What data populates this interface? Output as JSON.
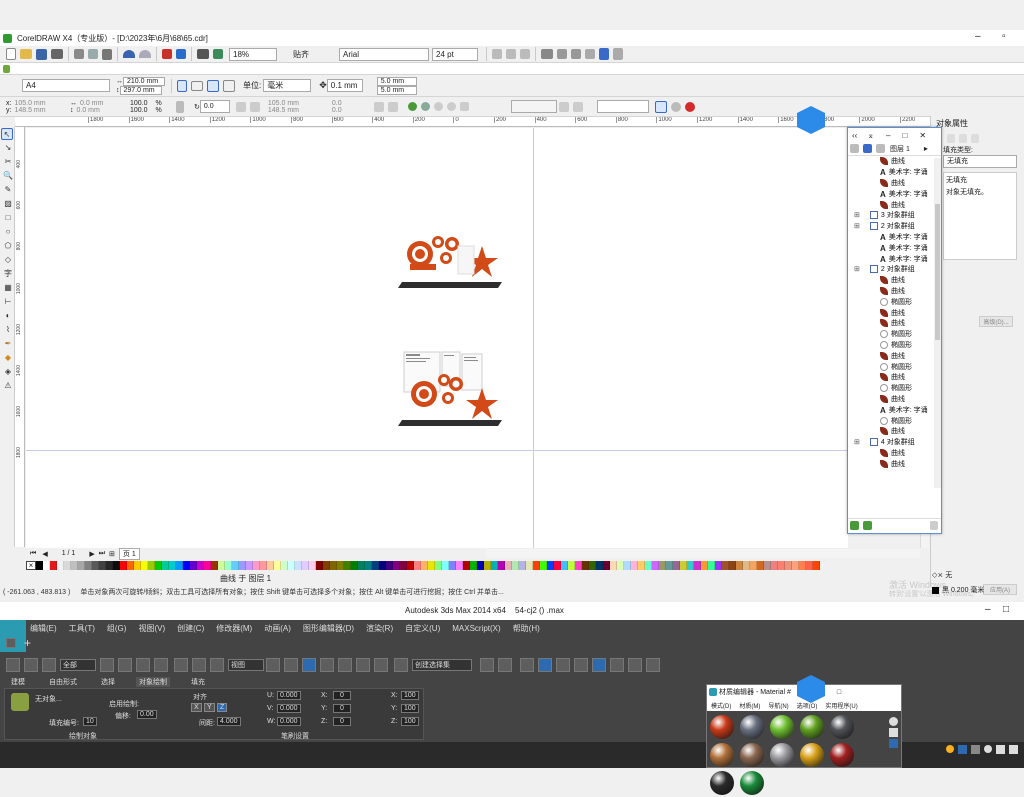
{
  "coreldraw": {
    "title": "CorelDRAW X4（专业版）- [D:\\2023年\\6月\\68\\65.cdr]",
    "window_controls": [
      "–",
      "▫"
    ],
    "zoom": "18%",
    "snap_label": "贴齐",
    "font_name": "Arial",
    "font_size": "24 pt",
    "page_size": "A4",
    "page_width": "210.0 mm",
    "page_height": "297.0 mm",
    "units_label": "单位:",
    "units_value": "毫米",
    "nudge": "0.1 mm",
    "dup_x": "5.0 mm",
    "dup_y": "5.0 mm",
    "pos_x": "105.0 mm",
    "pos_y": "148.5 mm",
    "size_w": "0.0 mm",
    "size_h": "0.0 mm",
    "scale_x": "100.0",
    "scale_y": "100.0",
    "pct": "%",
    "angle": "0.0",
    "center_x": "105.0 mm",
    "center_y": "148.5 mm",
    "skew_x": "0.0",
    "skew_y": "0.0",
    "ruler_ticks": [
      "1800",
      "1600",
      "1400",
      "1200",
      "1000",
      "800",
      "600",
      "400",
      "200",
      "0",
      "200",
      "400",
      "600",
      "800",
      "1000",
      "1200",
      "1400",
      "1600",
      "1800",
      "2000",
      "2200",
      "2400"
    ],
    "vruler_ticks": [
      "200",
      "400",
      "600",
      "800",
      "1000",
      "1200",
      "1400",
      "1600",
      "1800"
    ],
    "page_nav": "1 / 1",
    "page_tab": "页 1",
    "status_center": "曲线 于 图层 1",
    "status_left": "( -261.063 , 483.813 )",
    "status_hint": "单击对象两次可旋转/倾斜；双击工具可选择所有对象；按住 Shift 键单击可选择多个对象；按住 Alt 键单击可进行挖掘；按住 Ctrl 并单击...",
    "fill_status": "无",
    "outline_status": "黑 0.200 毫米"
  },
  "obj_manager": {
    "title": "对象管理器",
    "layer": "图层 1",
    "items": [
      {
        "kind": "curve",
        "label": "曲线",
        "indent": 1
      },
      {
        "kind": "text",
        "label": "美术字: 字诵",
        "indent": 1
      },
      {
        "kind": "curve",
        "label": "曲线",
        "indent": 1
      },
      {
        "kind": "text",
        "label": "美术字: 字诵",
        "indent": 1
      },
      {
        "kind": "curve",
        "label": "曲线",
        "indent": 1
      },
      {
        "kind": "group",
        "label": "3 对象群组",
        "indent": 0
      },
      {
        "kind": "group",
        "label": "2 对象群组",
        "indent": 0
      },
      {
        "kind": "text",
        "label": "美术字: 字诵",
        "indent": 1
      },
      {
        "kind": "text",
        "label": "美术字: 字诵",
        "indent": 1
      },
      {
        "kind": "text",
        "label": "美术字: 字诵",
        "indent": 1
      },
      {
        "kind": "group",
        "label": "2 对象群组",
        "indent": 0
      },
      {
        "kind": "curve",
        "label": "曲线",
        "indent": 1
      },
      {
        "kind": "curve",
        "label": "曲线",
        "indent": 1
      },
      {
        "kind": "ellipse",
        "label": "椭圆形",
        "indent": 1
      },
      {
        "kind": "curve",
        "label": "曲线",
        "indent": 1
      },
      {
        "kind": "curve",
        "label": "曲线",
        "indent": 1
      },
      {
        "kind": "ellipse",
        "label": "椭圆形",
        "indent": 1
      },
      {
        "kind": "ellipse",
        "label": "椭圆形",
        "indent": 1
      },
      {
        "kind": "curve",
        "label": "曲线",
        "indent": 1
      },
      {
        "kind": "ellipse",
        "label": "椭圆形",
        "indent": 1
      },
      {
        "kind": "curve",
        "label": "曲线",
        "indent": 1
      },
      {
        "kind": "ellipse",
        "label": "椭圆形",
        "indent": 1
      },
      {
        "kind": "curve",
        "label": "曲线",
        "indent": 1
      },
      {
        "kind": "text",
        "label": "美术字: 字诵",
        "indent": 1
      },
      {
        "kind": "ellipse",
        "label": "椭圆形",
        "indent": 1
      },
      {
        "kind": "curve",
        "label": "曲线",
        "indent": 1
      },
      {
        "kind": "group",
        "label": "4 对象群组",
        "indent": 0
      },
      {
        "kind": "curve",
        "label": "曲线",
        "indent": 1
      },
      {
        "kind": "curve",
        "label": "曲线",
        "indent": 1
      }
    ]
  },
  "obj_props": {
    "title": "对象属性",
    "fill_type_label": "填充类型:",
    "fill_type": "无填充",
    "fill_name": "无填充",
    "fill_desc": "对象无填充。",
    "advanced": "高级(D)...",
    "apply": "应用(A)"
  },
  "windows_watermark": [
    "激活 Windows",
    "转到'设置'以激活 Windows。"
  ],
  "max": {
    "title": "Autodesk 3ds Max  2014 x64",
    "file": "54-cj2 ()  .max",
    "menus": [
      "编辑(E)",
      "工具(T)",
      "组(G)",
      "视图(V)",
      "创建(C)",
      "修改器(M)",
      "动画(A)",
      "图形编辑器(D)",
      "渲染(R)",
      "自定义(U)",
      "MAXScript(X)",
      "帮助(H)"
    ],
    "select_all": "全部",
    "view_dd": "视图",
    "sel_set": "创建选择集",
    "ribbon_tabs": [
      "建模",
      "自由形式",
      "选择",
      "对象绘制",
      "填充"
    ],
    "no_object": "无对象...",
    "paint_label": "启用绘制:",
    "fill_num_label": "填充编号:",
    "fill_num": "10",
    "offset_label": "偏移:",
    "offset": "0.00",
    "paint_objects": "绘制对象",
    "align_label": "对齐",
    "spacing_label": "间距:",
    "spacing": "4.000",
    "u_label": "U:",
    "u": "0.000",
    "v_label": "V:",
    "v": "0.000",
    "w_label": "W:",
    "w": "0.000",
    "x_label": "X:",
    "x": "0",
    "y_label": "Y:",
    "y": "0",
    "z_label": "Z:",
    "z": "0",
    "sx_label": "X:",
    "sx": "100",
    "sy_label": "Y:",
    "sy": "100",
    "sz_label": "Z:",
    "sz": "100",
    "brush_settings": "笔刷设置",
    "axes": [
      "X",
      "Y",
      "Z"
    ]
  },
  "mat_editor": {
    "title": "材质编辑器 - Material #",
    "menus": [
      "模式(D)",
      "材质(M)",
      "导航(N)",
      "选项(O)",
      "实用程序(U)"
    ],
    "balls": [
      "#c83a18",
      "#6a7080",
      "#6fc030",
      "#60a020",
      "#505258",
      "#b0703a",
      "#8a6650",
      "#9a9aa0",
      "#d8a018",
      "#a02020",
      "#2a2a2a",
      "#1a8a3a"
    ]
  },
  "palette": [
    "#000000",
    "#ffffff",
    "#e31a1c",
    "#f2f2f2",
    "#d9d9d9",
    "#bfbfbf",
    "#a6a6a6",
    "#808080",
    "#595959",
    "#404040",
    "#262626",
    "#0d0d0d",
    "#ff0000",
    "#ff6600",
    "#ffcc00",
    "#ffff00",
    "#99cc00",
    "#00cc00",
    "#00cc99",
    "#00cccc",
    "#0099ff",
    "#0000ff",
    "#6600cc",
    "#cc00cc",
    "#ff0099",
    "#993300",
    "#ccff99",
    "#99ffcc",
    "#66ccff",
    "#9999ff",
    "#cc99ff",
    "#ff99cc",
    "#ff9999",
    "#ffcc99",
    "#ffff99",
    "#ccffcc",
    "#ccffff",
    "#cce0ff",
    "#e0ccff",
    "#ffccee",
    "#800000",
    "#804000",
    "#806600",
    "#808000",
    "#408000",
    "#008000",
    "#008060",
    "#008080",
    "#004080",
    "#000080",
    "#400080",
    "#800080",
    "#800040",
    "#c00000",
    "#ff8080",
    "#ffb366",
    "#e6e600",
    "#80ff80",
    "#80ffff",
    "#8080ff",
    "#ff80ff",
    "#b30000",
    "#00b300",
    "#0000b3",
    "#b3b300",
    "#00b3b3",
    "#b300b3",
    "#e6b3b3",
    "#b3e6b3",
    "#b3b3e6",
    "#e6e6b3",
    "#ff4000",
    "#40ff00",
    "#0040ff",
    "#ff0040",
    "#40c0ff",
    "#c0ff40",
    "#ff40c0",
    "#663300",
    "#336600",
    "#003366",
    "#660033",
    "#ffd9b3",
    "#d9ffb3",
    "#b3d9ff",
    "#ffb3d9",
    "#ffcc66",
    "#66ffcc",
    "#cc66ff",
    "#999966",
    "#669999",
    "#996699",
    "#cccc33",
    "#33cccc",
    "#cc33cc",
    "#ff9933",
    "#33ff99",
    "#9933ff",
    "#a0522d",
    "#8b4513",
    "#cd853f",
    "#deb887",
    "#f4a460",
    "#d2691e",
    "#bc8f8f",
    "#f08080",
    "#fa8072",
    "#e9967a",
    "#ffa07a",
    "#ff7f50",
    "#ff6347",
    "#ff4500"
  ]
}
